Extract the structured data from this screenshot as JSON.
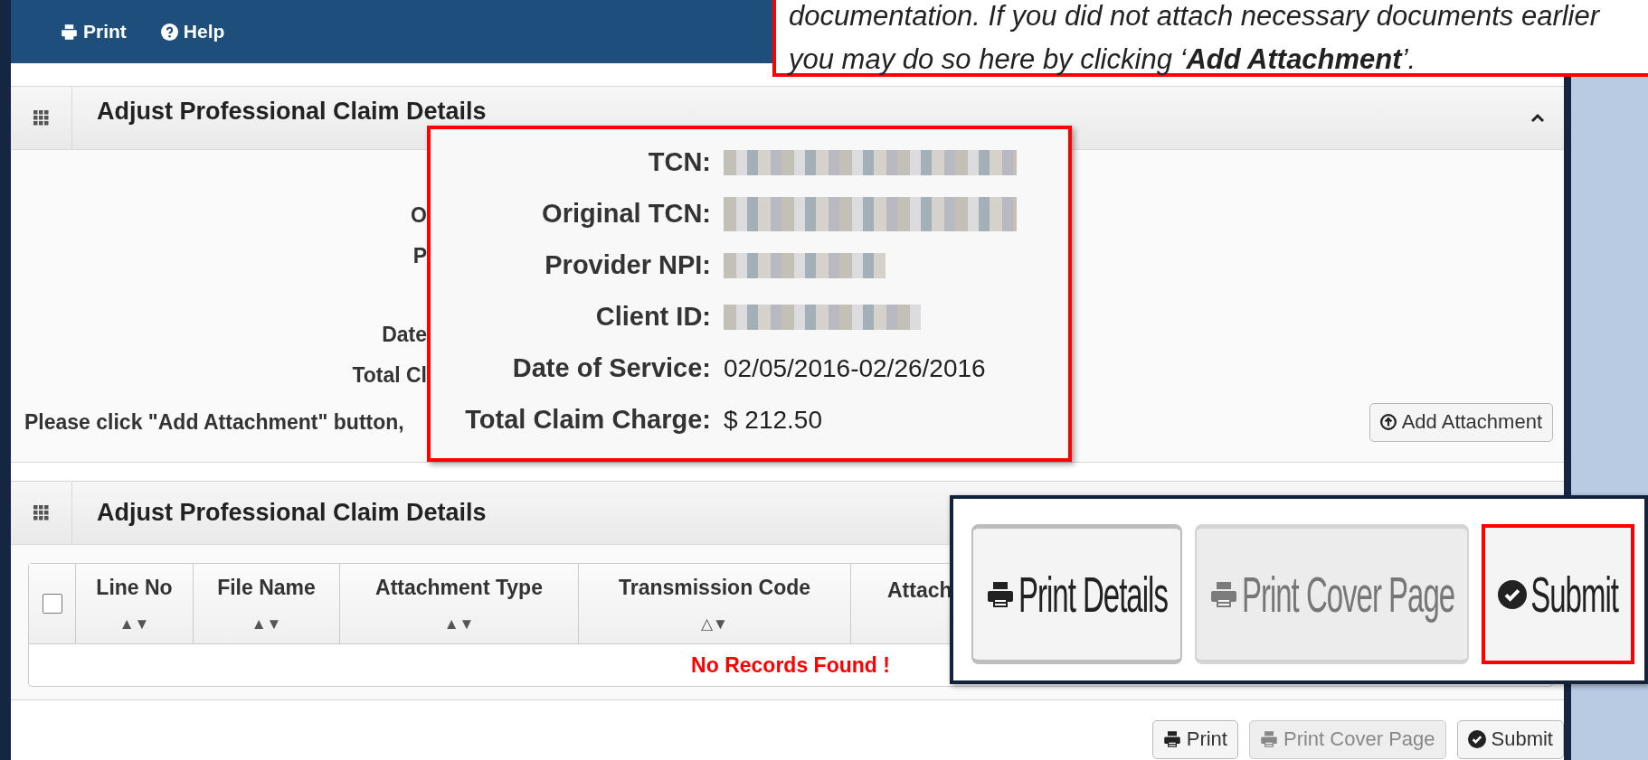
{
  "top_bar": {
    "links": [
      {
        "label": "Print",
        "kind": "print"
      },
      {
        "label": "Help",
        "kind": "help"
      }
    ]
  },
  "note_callout": {
    "lines": [
      "documentation. If you did not attach necessary documents earlier",
      "you may do so here by clicking ‘**Add Attachment**’."
    ]
  },
  "claim_panel": {
    "title": "Adjust Professional Claim Details",
    "expanded": true,
    "field_labels": [
      "O",
      "P",
      "Date",
      "Total Cl"
    ],
    "note": "Please click \"Add Attachment\" button,",
    "add_button": "Add Attachment"
  },
  "details_callout": {
    "rows": [
      {
        "label": "TCN:",
        "redacted": true
      },
      {
        "label": "Original TCN:",
        "redacted": true
      },
      {
        "label": "Provider NPI:",
        "redacted": true
      },
      {
        "label": "Client ID:",
        "redacted": true
      },
      {
        "label": "Date of Service:",
        "value": "02/05/2016-02/26/2016",
        "redacted": false
      },
      {
        "label": "Total Claim Charge:",
        "value": "$ 212.50",
        "redacted": false
      }
    ]
  },
  "attachments_panel": {
    "title": "Adjust Professional Claim Details",
    "select_all_checked": false,
    "columns": [
      {
        "label": "Line No",
        "sort": "▲▼"
      },
      {
        "label": "File Name",
        "sort": "▲▼"
      },
      {
        "label": "Attachment Type",
        "sort": "▲▼"
      },
      {
        "label": "Transmission Code",
        "sort": "△▼"
      },
      {
        "label": "Attach"
      }
    ],
    "empty_message": "No Records Found !"
  },
  "buttons": [
    {
      "label": "Print",
      "kind": "print",
      "disabled": false
    },
    {
      "label": "Print Cover Page",
      "kind": "print",
      "disabled": true
    },
    {
      "label": "Submit",
      "kind": "submit",
      "disabled": false
    }
  ],
  "buttons_callout": {
    "buttons": [
      {
        "label": "Print Details",
        "kind": "print",
        "disabled": false,
        "highlighted": false
      },
      {
        "label": "Print Cover Page",
        "kind": "print",
        "disabled": true,
        "highlighted": false
      },
      {
        "label": "Submit",
        "kind": "submit",
        "disabled": false,
        "highlighted": true
      }
    ]
  }
}
